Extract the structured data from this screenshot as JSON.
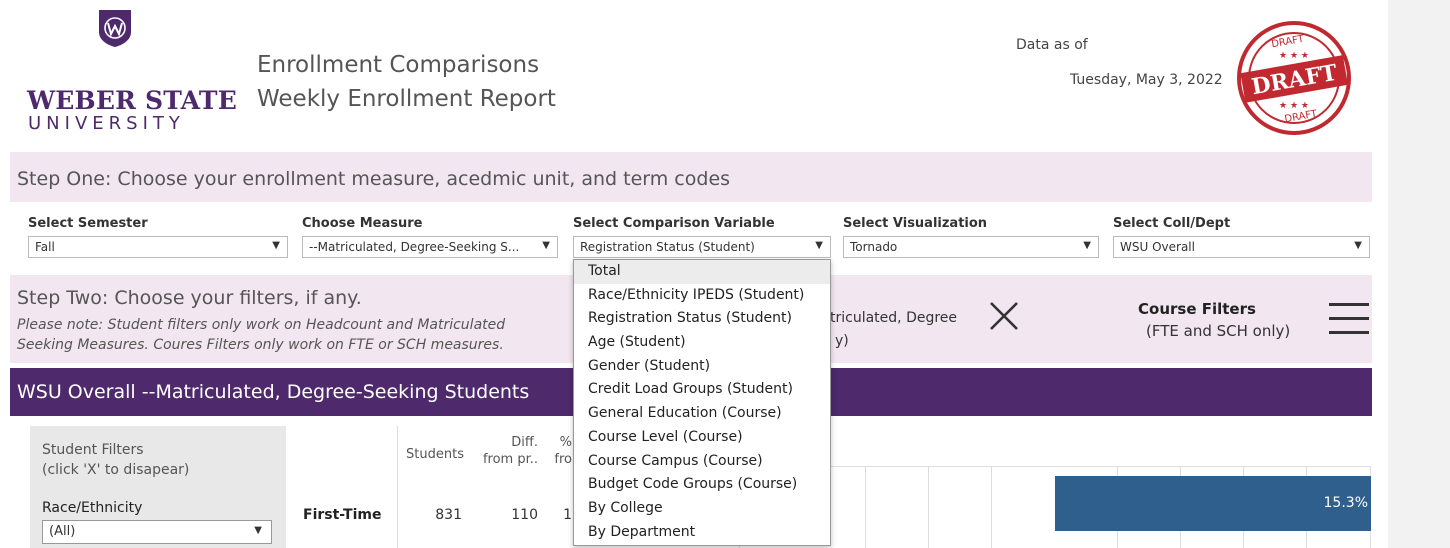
{
  "header": {
    "logo_name": "WEBER STATE",
    "logo_sub": "UNIVERSITY",
    "title_line1": "Enrollment Comparisons",
    "title_line2": "Weekly Enrollment Report",
    "data_as_of_label": "Data as of",
    "data_as_of_date": "Tuesday, May 3, 2022",
    "stamp_text": "DRAFT"
  },
  "step_one": {
    "heading": "Step One:  Choose your enrollment measure, acedmic unit, and term codes",
    "filters": [
      {
        "label": "Select Semester",
        "value": "Fall"
      },
      {
        "label": "Choose Measure",
        "value": "--Matriculated, Degree-Seeking S..."
      },
      {
        "label": "Select Comparison Variable",
        "value": "Registration Status (Student)"
      },
      {
        "label": "Select Visualization",
        "value": "Tornado"
      },
      {
        "label": "Select Coll/Dept",
        "value": "WSU Overall"
      }
    ]
  },
  "step_two": {
    "heading": "Step Two:  Choose your filters, if any.",
    "note_line1": "Please note:  Student filters only work on Headcount and Matriculated",
    "note_line2": "Seeking Measures.  Coures Filters only work on FTE or SCH measures.",
    "obscured_text1": "triculated, Degree",
    "obscured_text2": "y)",
    "course_filters_title": "Course Filters",
    "course_filters_sub": "(FTE and SCH only)"
  },
  "banner": {
    "title": "WSU Overall --Matriculated, Degree-Seeking Students"
  },
  "student_filters": {
    "title": "Student Filters",
    "hint": "(click 'X' to disapear)",
    "race_label": "Race/Ethnicity",
    "race_value": "(All)"
  },
  "table": {
    "headers": {
      "students": "Students",
      "diff_line1": "Diff.",
      "diff_line2": "from pr..",
      "pct_line1": "%",
      "pct_line2": "fro"
    },
    "row": {
      "label": "First-Time",
      "students": "831",
      "diff": "110",
      "pct": "1"
    }
  },
  "chart_data": {
    "type": "bar",
    "categories": [
      "First-Time"
    ],
    "values": [
      15.3
    ],
    "value_labels": [
      "15.3%"
    ]
  },
  "dropdown": {
    "items": [
      "Total",
      "Race/Ethnicity IPEDS (Student)",
      "Registration Status (Student)",
      "Age (Student)",
      "Gender (Student)",
      "Credit Load Groups (Student)",
      "General Education (Course)",
      "Course Level (Course)",
      "Course Campus (Course)",
      "Budget Code Groups (Course)",
      "By College",
      "By Department"
    ],
    "highlighted": "Total"
  },
  "colors": {
    "purple": "#4e2a6d",
    "light_purple": "#f2e6f1",
    "bar_blue": "#2e5f8d",
    "stamp_red": "#c0292f"
  }
}
